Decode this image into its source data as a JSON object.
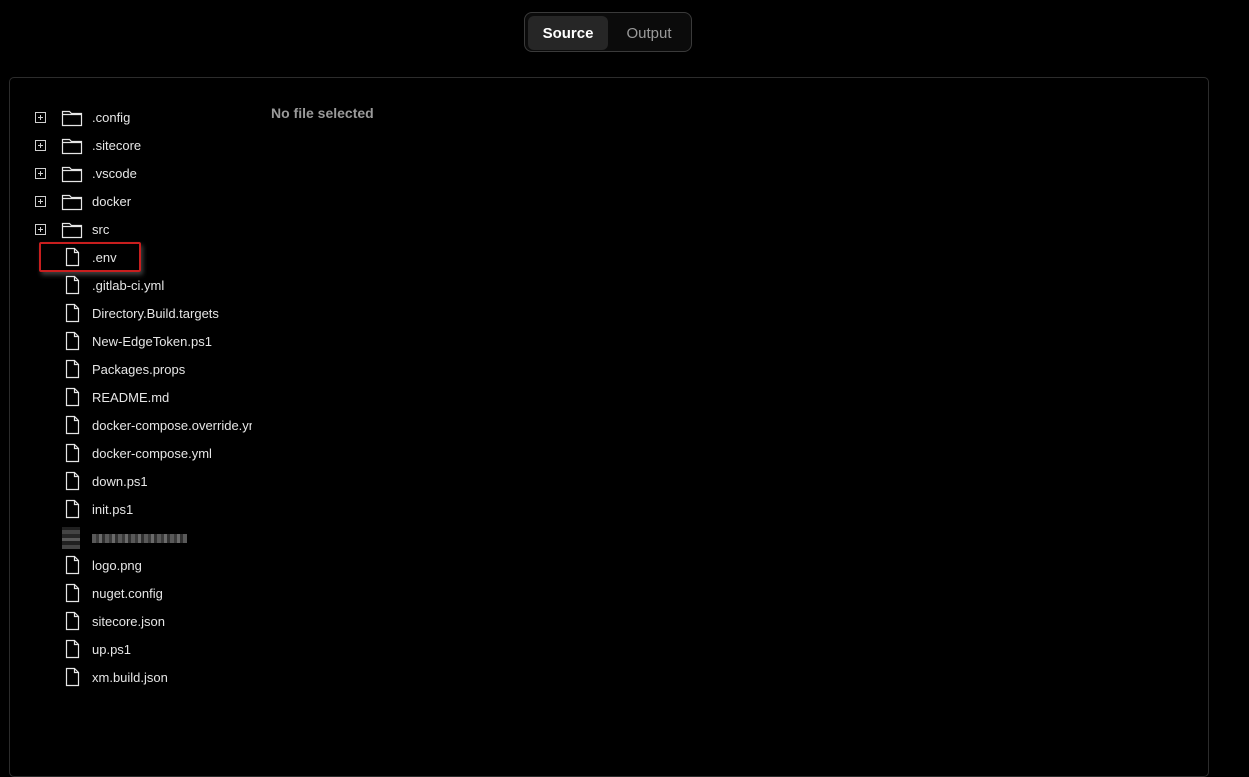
{
  "tabs": {
    "source": "Source",
    "output": "Output"
  },
  "viewer": {
    "empty_message": "No file selected"
  },
  "tree": {
    "folders": [
      {
        "label": ".config"
      },
      {
        "label": ".sitecore"
      },
      {
        "label": ".vscode"
      },
      {
        "label": "docker"
      },
      {
        "label": "src"
      }
    ],
    "files": [
      {
        "label": ".env",
        "selected": true
      },
      {
        "label": ".gitlab-ci.yml"
      },
      {
        "label": "Directory.Build.targets"
      },
      {
        "label": "New-EdgeToken.ps1"
      },
      {
        "label": "Packages.props"
      },
      {
        "label": "README.md"
      },
      {
        "label": "docker-compose.override.yml"
      },
      {
        "label": "docker-compose.yml"
      },
      {
        "label": "down.ps1"
      },
      {
        "label": "init.ps1"
      },
      {
        "label": ""
      },
      {
        "label": "logo.png"
      },
      {
        "label": "nuget.config"
      },
      {
        "label": "sitecore.json"
      },
      {
        "label": "up.ps1"
      },
      {
        "label": "xm.build.json"
      }
    ]
  },
  "colors": {
    "highlight": "#c81e1e",
    "background": "#000000"
  },
  "icons": {
    "expander": "plus-square-icon",
    "folder": "folder-icon",
    "file": "file-icon"
  }
}
